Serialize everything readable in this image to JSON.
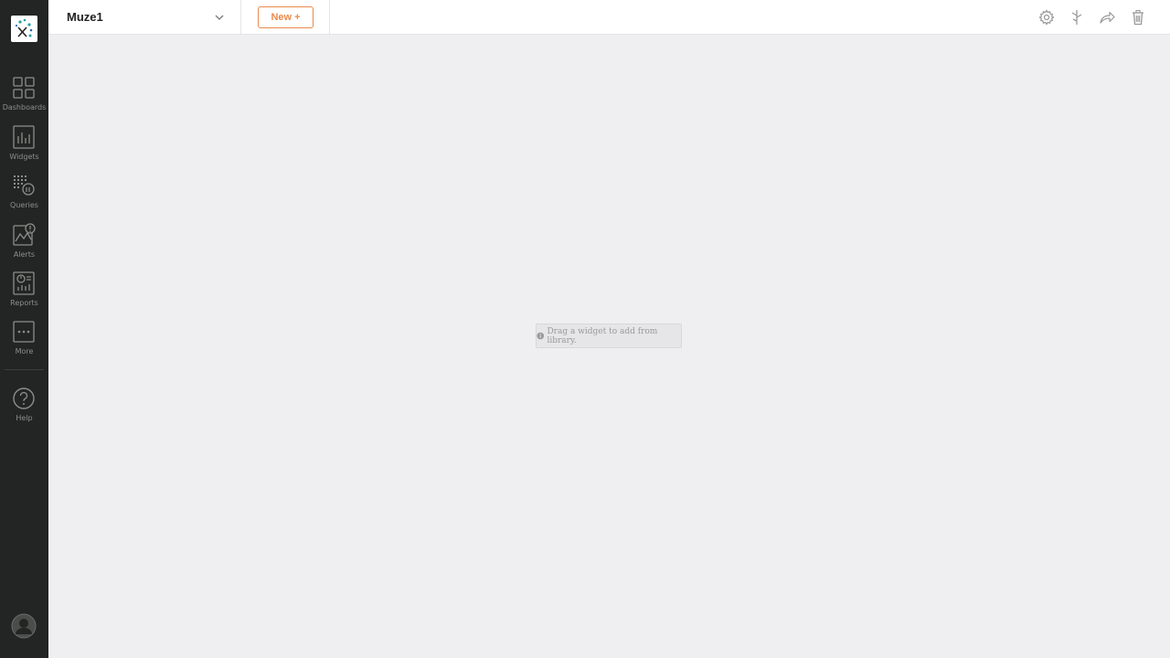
{
  "sidebar": {
    "logo_icon": "muze-logo-icon",
    "items": [
      {
        "label": "Dashboards",
        "icon": "dashboard-grid-icon"
      },
      {
        "label": "Widgets",
        "icon": "bar-chart-icon"
      },
      {
        "label": "Queries",
        "icon": "query-icon"
      },
      {
        "label": "Alerts",
        "icon": "alert-icon"
      },
      {
        "label": "Reports",
        "icon": "report-icon"
      },
      {
        "label": "More",
        "icon": "more-icon"
      },
      {
        "label": "Help",
        "icon": "help-icon"
      }
    ],
    "profile_icon": "user-avatar-icon"
  },
  "header": {
    "dashboard_name": "Muze1",
    "new_button": "New +",
    "tools": [
      "settings-icon",
      "filter-icon",
      "share-icon",
      "delete-icon"
    ]
  },
  "canvas": {
    "empty_hint": "Drag a widget to add from library."
  },
  "colors": {
    "sidebar_bg": "#222523",
    "accent": "#e98a4c",
    "canvas_bg": "#efeff1"
  }
}
